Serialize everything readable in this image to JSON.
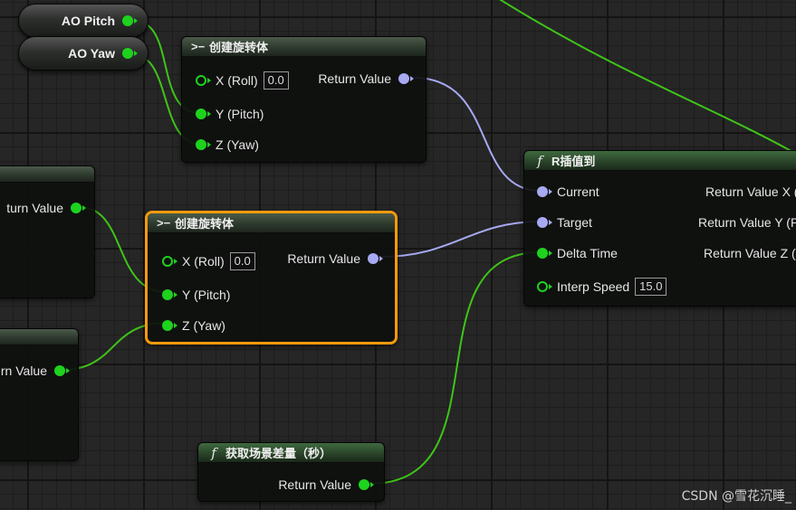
{
  "variables": {
    "ao_pitch": "AO Pitch",
    "ao_yaw": "AO Yaw"
  },
  "make_rotator_top": {
    "title": "创建旋转体",
    "x_label": "X (Roll)",
    "x_value": "0.0",
    "y_label": "Y (Pitch)",
    "z_label": "Z (Yaw)",
    "return_label": "Return Value"
  },
  "make_rotator_selected": {
    "title": "创建旋转体",
    "x_label": "X (Roll)",
    "x_value": "0.0",
    "y_label": "Y (Pitch)",
    "z_label": "Z (Yaw)",
    "return_label": "Return Value"
  },
  "left_node_1": {
    "return_label": "turn Value"
  },
  "left_node_2": {
    "return_label": "rn Value"
  },
  "rinterp": {
    "title": "R插值到",
    "current_label": "Current",
    "target_label": "Target",
    "delta_label": "Delta Time",
    "speed_label": "Interp Speed",
    "speed_value": "15.0",
    "out_x": "Return Value X (",
    "out_y": "Return Value Y (P",
    "out_z": "Return Value Z (Y"
  },
  "delta_node": {
    "title": "获取场景差量（秒）",
    "return_label": "Return Value"
  },
  "watermark": "CSDN @雪花沉睡_",
  "colors": {
    "exec_wire": "#3fc418",
    "float_pin": "#1ed21e",
    "rotator_pin": "#a7a9f2",
    "selected_border": "#f29a0c"
  }
}
